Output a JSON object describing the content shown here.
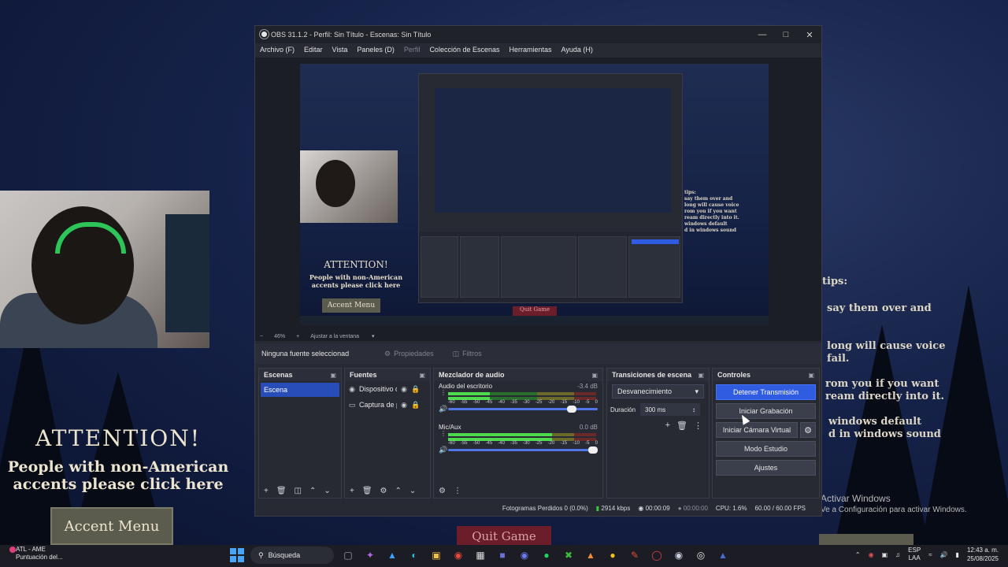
{
  "obs": {
    "title": "OBS 31.1.2 - Perfil: Sin Título - Escenas: Sin Título",
    "menu": [
      "Archivo (F)",
      "Editar",
      "Vista",
      "Paneles (D)",
      "Perfil",
      "Colección de Escenas",
      "Herramientas",
      "Ayuda (H)"
    ],
    "zoom": "46%",
    "fit_label": "Ajustar a la ventana",
    "no_source": "Ninguna fuente seleccionad",
    "properties": "Propiedades",
    "filters": "Filtros",
    "scenes": {
      "title": "Escenas",
      "items": [
        "Escena"
      ]
    },
    "sources": {
      "title": "Fuentes",
      "items": [
        "Dispositivo d",
        "Captura de p"
      ]
    },
    "mixer": {
      "title": "Mezclador de audio",
      "ticks": [
        "-60",
        "-55",
        "-50",
        "-45",
        "-40",
        "-35",
        "-30",
        "-25",
        "-20",
        "-15",
        "-10",
        "-5",
        "0"
      ],
      "channels": [
        {
          "name": "Audio del escritorio",
          "db": "-3.4 dB",
          "level": 0.28,
          "volume": 0.86
        },
        {
          "name": "Mic/Aux",
          "db": "0.0 dB",
          "level": 0.7,
          "volume": 1.0
        }
      ]
    },
    "transitions": {
      "title": "Transiciones de escena",
      "type": "Desvanecimiento",
      "duration_label": "Duración",
      "duration": "300 ms"
    },
    "controls": {
      "title": "Controles",
      "stop_stream": "Detener Transmisión",
      "start_recording": "Iniciar Grabación",
      "virtual_cam": "Iniciar Cámara Virtual",
      "studio_mode": "Modo Estudio",
      "settings": "Ajustes"
    },
    "status": {
      "dropped": "Fotogramas Perdidos 0 (0.0%)",
      "kbps": "2914 kbps",
      "stream_time": "00:00:09",
      "rec_time": "00:00:00",
      "cpu": "CPU: 1.6%",
      "fps": "60.00 / 60.00 FPS"
    }
  },
  "game": {
    "attention": "ATTENTION!",
    "people_line1": "People with non-American",
    "people_line2": "accents please click here",
    "accent_menu": "Accent Menu",
    "quit": "Quit Game",
    "tips": [
      "tips:",
      "say them over and",
      "long will cause voice",
      "fail.",
      "rom you if you want",
      "ream directly into it.",
      "windows default",
      "d in windows sound"
    ],
    "activate_title": "Activar Windows",
    "activate_sub": "Ve a Configuración para activar Windows."
  },
  "taskbar": {
    "app_name": "ATL - AME",
    "app_sub": "Puntuación del...",
    "search": "Búsqueda",
    "lang1": "ESP",
    "lang2": "LAA",
    "time": "12:43 a. m.",
    "date": "25/08/2025"
  },
  "colors": {
    "accent": "#2f5ce0",
    "scene_selected": "#284cb8",
    "meter_green": "#4ddb4d"
  }
}
